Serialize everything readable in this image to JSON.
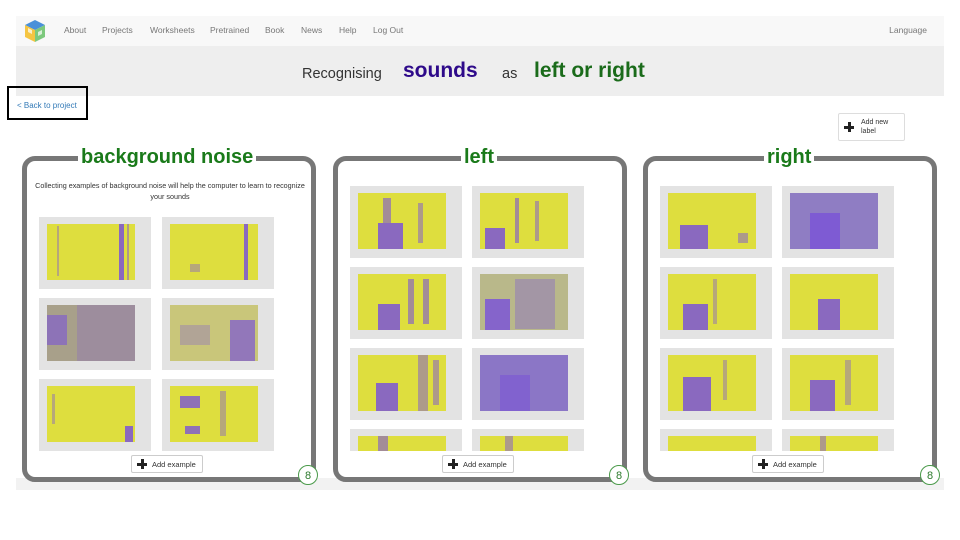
{
  "nav": {
    "links": [
      "About",
      "Projects",
      "Worksheets",
      "Pretrained",
      "Book",
      "News",
      "Help",
      "Log Out"
    ],
    "language": "Language"
  },
  "header": {
    "recognising": "Recognising",
    "data_type": "sounds",
    "as": "as",
    "target": "left or right"
  },
  "back_link": "< Back to project",
  "add_label_button": "Add new label",
  "labels": [
    {
      "name": "background noise",
      "description": "Collecting examples of background noise will help the computer to learn to recognize your sounds",
      "add_example": "Add example",
      "count": "8"
    },
    {
      "name": "left",
      "add_example": "Add example",
      "count": "8"
    },
    {
      "name": "right",
      "add_example": "Add example",
      "count": "8"
    }
  ],
  "colors": {
    "accent_green": "#1a7a1a",
    "sounds_purple": "#2e0a8a",
    "spectrogram_yellow": "#dede3e",
    "spectrogram_purple": "#7b55d6"
  }
}
